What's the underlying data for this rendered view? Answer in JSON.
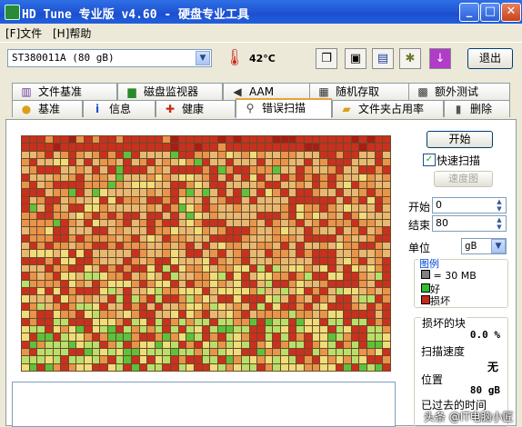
{
  "window": {
    "title": "HD Tune 专业版 v4.60 - 硬盘专业工具"
  },
  "menu": {
    "items": [
      "[F]文件",
      "[H]帮助"
    ]
  },
  "toolbar": {
    "drive": "ST380011A (80 gB)",
    "temperature": "42°C",
    "exit_label": "退出",
    "icons": [
      "copy-icon",
      "paste-icon",
      "save-icon",
      "options-icon",
      "download-icon"
    ]
  },
  "tabs": {
    "row1": [
      "文件基准",
      "磁盘监视器",
      "AAM",
      "随机存取",
      "额外测试"
    ],
    "row2": [
      "基准",
      "信息",
      "健康",
      "错误扫描",
      "文件夹占用率",
      "删除"
    ],
    "active": "错误扫描"
  },
  "scan": {
    "start_label": "开始",
    "quick_scan_label": "快速扫描",
    "quick_scan_checked": true,
    "speed_map_label": "速度图",
    "start_field_label": "开始",
    "start_value": "0",
    "end_field_label": "结束",
    "end_value": "80",
    "unit_label": "单位",
    "unit_value": "gB"
  },
  "legend": {
    "title": "图例",
    "block_size": "= 30 MB",
    "good": "好",
    "damaged": "损坏",
    "colors": {
      "block": "#808080",
      "good": "#2fbf2f",
      "damaged": "#c82818"
    }
  },
  "stats": {
    "damaged_blocks_label": "损坏的块",
    "damaged_blocks_value": "0.0 %",
    "scan_speed_label": "扫描速度",
    "scan_speed_value": "无",
    "position_label": "位置",
    "position_value": "80 gB",
    "elapsed_label": "已过去的时间"
  },
  "watermark": "头条 @IT电脑小匠",
  "palette": {
    "red": "#c9301e",
    "dark_red": "#a81e14",
    "orange": "#e8944a",
    "tan": "#e7b872",
    "yellow": "#eedd7a",
    "light_green": "#b8df6a",
    "green": "#5cc23a"
  }
}
